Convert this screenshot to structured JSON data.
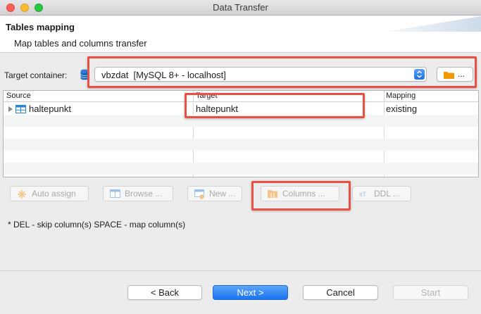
{
  "window": {
    "title": "Data Transfer"
  },
  "header": {
    "title": "Tables mapping",
    "subtitle": "Map tables and columns transfer"
  },
  "target_container": {
    "label": "Target container:",
    "value": "vbzdat  [MySQL 8+ - localhost]",
    "browse_label": "..."
  },
  "table": {
    "columns": [
      "Source",
      "Target",
      "Mapping"
    ],
    "rows": [
      {
        "source": "haltepunkt",
        "target": "haltepunkt",
        "mapping": "existing"
      }
    ]
  },
  "toolbar": {
    "auto_assign": "Auto assign",
    "browse": "Browse ...",
    "new": "New ...",
    "columns": "Columns ...",
    "ddl": "DDL ..."
  },
  "hint": "* DEL - skip column(s)  SPACE - map column(s)",
  "nav": {
    "back": "< Back",
    "next": "Next >",
    "cancel": "Cancel",
    "start": "Start"
  },
  "colors": {
    "highlight": "#ea4f43",
    "primary": "#1d73f0",
    "disabled_text": "#a9a9a9"
  }
}
